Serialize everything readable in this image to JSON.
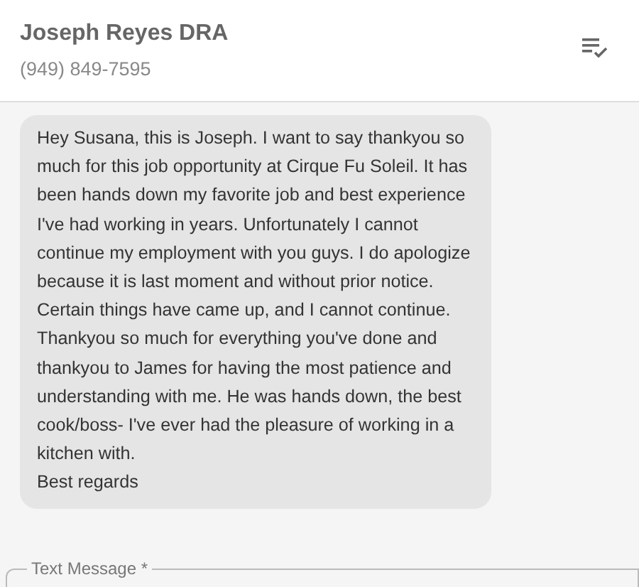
{
  "contact": {
    "name": "Joseph Reyes DRA",
    "phone": "(949) 849-7595"
  },
  "messages": [
    {
      "text": "Hey Susana, this is Joseph. I want to say thankyou so much for this job opportunity at Cirque Fu Soleil. It has been hands down my favorite job and best experience I've had working in years. Unfortunately I cannot continue my employment with you guys. I do apologize because it is last moment and without prior notice. Certain things have came up, and I cannot continue. Thankyou so much for everything you've done and thankyou to James for having the most patience and understanding with me. He was hands down, the best cook/boss- I've ever had the pleasure of working in a kitchen with.\nBest regards"
    }
  ],
  "composer": {
    "label": "Text Message *"
  }
}
